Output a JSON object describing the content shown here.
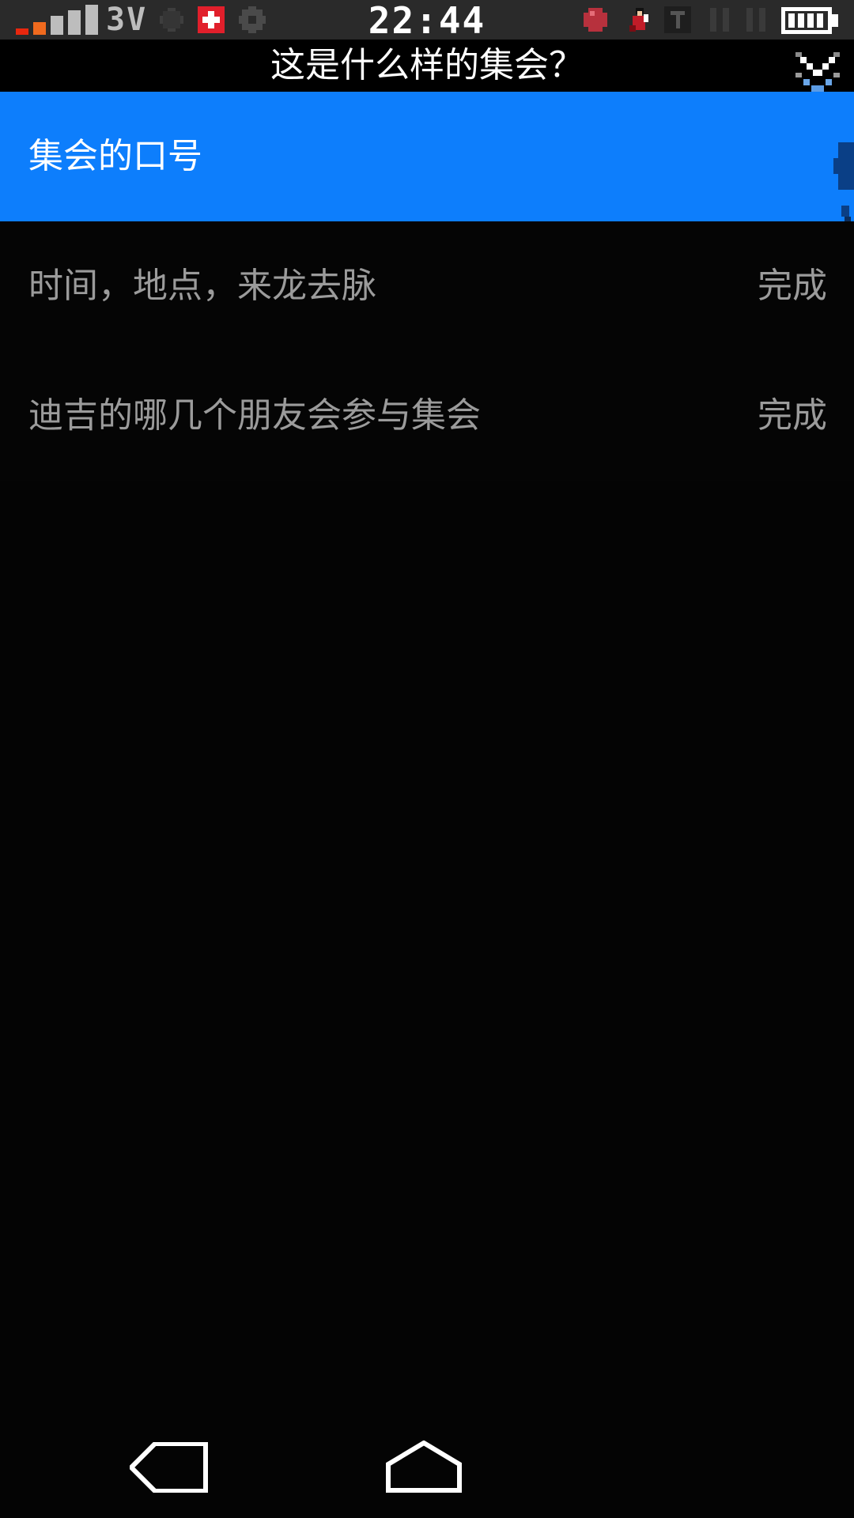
{
  "status_bar": {
    "network_type": "3V",
    "time": "22:44",
    "icons": [
      "signal-icon",
      "fan-icon",
      "medical-cross-icon",
      "gear-icon",
      "fruit-icon",
      "character-icon",
      "t-icon",
      "pause-icon",
      "pause-icon",
      "battery-icon"
    ],
    "colors": {
      "signal_low": "#e8270e",
      "signal_mid": "#f06a1e",
      "signal_high": "#bdbdbd",
      "medical": "#e11f2b"
    }
  },
  "header": {
    "title": "这是什么样的集会？",
    "collapse_icon": "chevron-down-icon"
  },
  "list": {
    "selected_color": "#0d7efc",
    "items": [
      {
        "label": "集会的口号",
        "status": "",
        "selected": true
      },
      {
        "label": "时间，地点，来龙去脉",
        "status": "完成",
        "selected": false
      },
      {
        "label": "迪吉的哪几个朋友会参与集会",
        "status": "完成",
        "selected": false
      }
    ]
  },
  "nav_bar": {
    "buttons": [
      "back-icon",
      "home-icon"
    ]
  }
}
